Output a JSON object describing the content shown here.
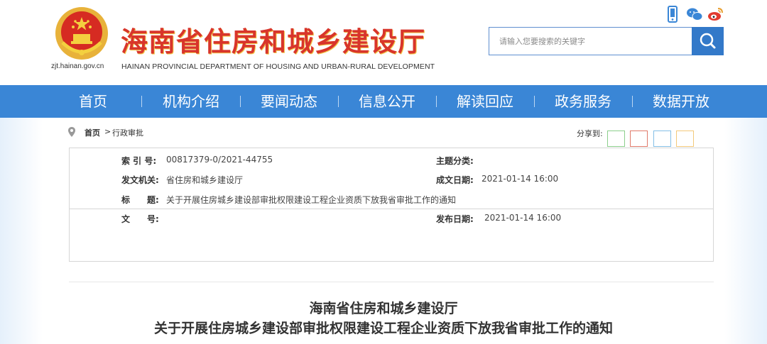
{
  "header": {
    "domain": "zjt.hainan.gov.cn",
    "title": "海南省住房和城乡建设厅",
    "subtitle": "HAINAN PROVINCIAL DEPARTMENT OF HOUSING AND URBAN-RURAL DEVELOPMENT",
    "icons": [
      "mobile-icon",
      "wechat-icon",
      "weibo-icon"
    ],
    "search": {
      "placeholder": "请输入您要搜索的关键字"
    }
  },
  "nav": {
    "items": [
      "首页",
      "机构介绍",
      "要闻动态",
      "信息公开",
      "解读回应",
      "政务服务",
      "数据开放"
    ]
  },
  "breadcrumb": {
    "home": "首页",
    "separator": ">",
    "current": "行政审批"
  },
  "share": {
    "label": "分享到:",
    "colors": [
      "#8ccf8c",
      "#e07a6a",
      "#84bfe6",
      "#f3c97a"
    ]
  },
  "info": {
    "index_label": "索 引 号:",
    "index_value": "00817379-0/2021-44755",
    "topic_label": "主题分类:",
    "topic_value": "",
    "issuer_label": "发文机关:",
    "issuer_value": "省住房和城乡建设厅",
    "created_label": "成文日期:",
    "created_value": "2021-01-14 16:00",
    "title_label": "标　　题:",
    "title_value": "关于开展住房城乡建设部审批权限建设工程企业资质下放我省审批工作的通知",
    "docno_label": "文　　号:",
    "docno_value": "",
    "published_label": "发布日期:",
    "published_value": "2021-01-14 16:00"
  },
  "document": {
    "org": "海南省住房和城乡建设厅",
    "title": "关于开展住房城乡建设部审批权限建设工程企业资质下放我省审批工作的通知"
  },
  "colors": {
    "brand_red": "#d8352b",
    "nav_blue": "#3a86d6",
    "search_blue": "#3379c9"
  }
}
